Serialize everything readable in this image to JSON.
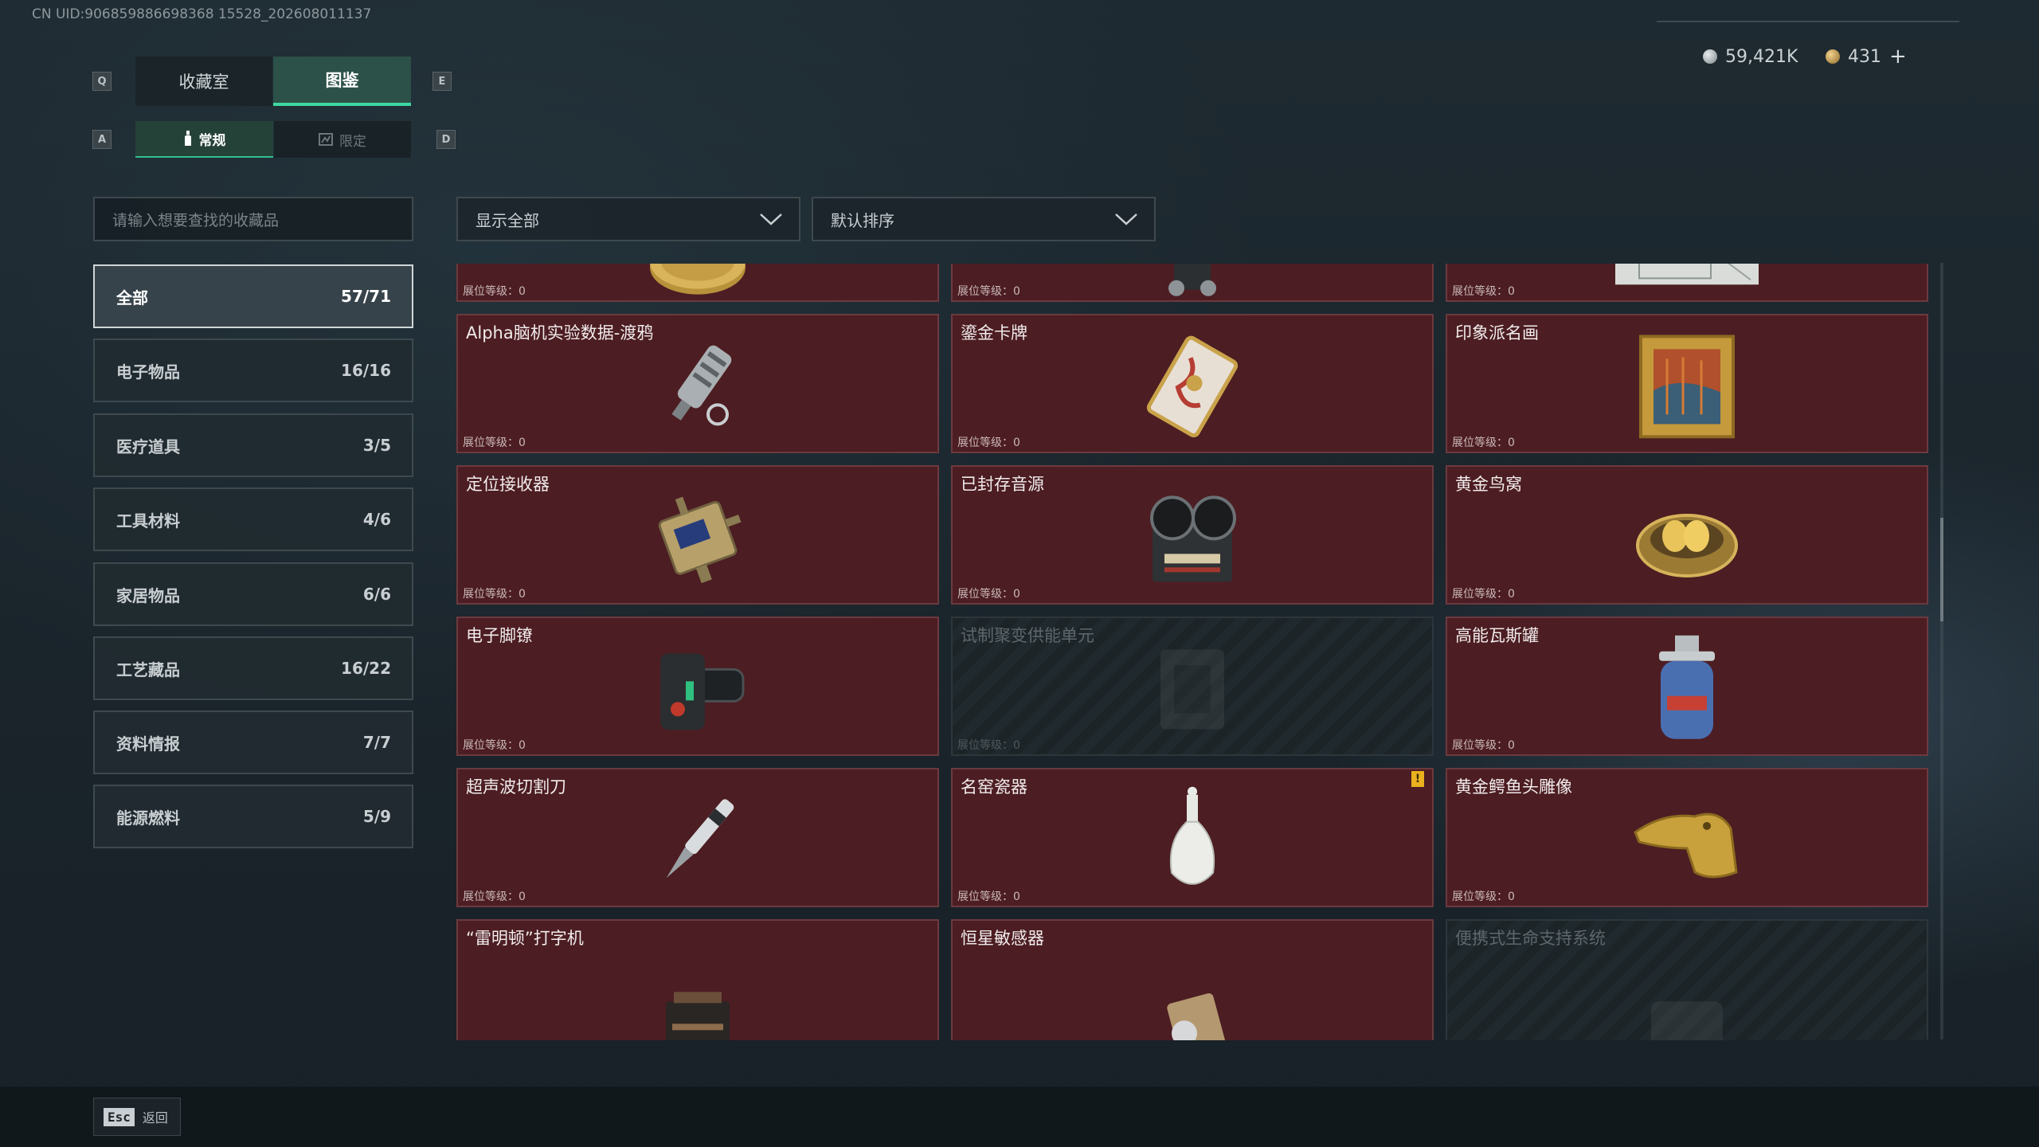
{
  "header": {
    "uid": "CN UID:906859886698368 15528_202608011137",
    "hint_left_top": "Q",
    "hint_right_top": "E",
    "hint_left_sub": "A",
    "hint_right_sub": "D",
    "tabs": [
      "收藏室",
      "图鉴"
    ],
    "subtabs": [
      "常规",
      "限定"
    ],
    "currency": [
      {
        "value": "59,421K",
        "color": "#b9c0c4"
      },
      {
        "value": "431",
        "color": "#c8a15a"
      }
    ],
    "add_label": "+"
  },
  "search": {
    "placeholder": "请输入想要查找的收藏品"
  },
  "filters": {
    "show": "显示全部",
    "sort": "默认排序"
  },
  "categories": [
    {
      "label": "全部",
      "count": "57/71"
    },
    {
      "label": "电子物品",
      "count": "16/16"
    },
    {
      "label": "医疗道具",
      "count": "3/5"
    },
    {
      "label": "工具材料",
      "count": "4/6"
    },
    {
      "label": "家居物品",
      "count": "6/6"
    },
    {
      "label": "工艺藏品",
      "count": "16/22"
    },
    {
      "label": "资料情报",
      "count": "7/7"
    },
    {
      "label": "能源燃料",
      "count": "5/9"
    }
  ],
  "level_label": "展位等级：0",
  "items": [
    {
      "name": "",
      "icon": "caviar-tin-icon",
      "locked": false
    },
    {
      "name": "",
      "icon": "old-telephone-icon",
      "locked": false
    },
    {
      "name": "",
      "icon": "blueprint-map-icon",
      "locked": false
    },
    {
      "name": "Alpha脑机实验数据-渡鸦",
      "icon": "data-capsule-icon",
      "locked": false
    },
    {
      "name": "鎏金卡牌",
      "icon": "gilded-card-icon",
      "locked": false
    },
    {
      "name": "印象派名画",
      "icon": "framed-painting-icon",
      "locked": false
    },
    {
      "name": "定位接收器",
      "icon": "locator-receiver-icon",
      "locked": false
    },
    {
      "name": "已封存音源",
      "icon": "reel-recorder-icon",
      "locked": false
    },
    {
      "name": "黄金鸟窝",
      "icon": "golden-nest-icon",
      "locked": false
    },
    {
      "name": "电子脚镣",
      "icon": "ankle-monitor-icon",
      "locked": false
    },
    {
      "name": "试制聚变供能单元",
      "icon": "fusion-unit-icon",
      "locked": true
    },
    {
      "name": "高能瓦斯罐",
      "icon": "gas-canister-icon",
      "locked": false
    },
    {
      "name": "超声波切割刀",
      "icon": "ultrasonic-knife-icon",
      "locked": false
    },
    {
      "name": "名窑瓷器",
      "icon": "porcelain-vase-icon",
      "locked": false,
      "badge": "!"
    },
    {
      "name": "黄金鳄鱼头雕像",
      "icon": "golden-crocodile-icon",
      "locked": false
    },
    {
      "name": "“雷明顿”打字机",
      "icon": "typewriter-icon",
      "locked": false
    },
    {
      "name": "恒星敏感器",
      "icon": "star-sensor-icon",
      "locked": false
    },
    {
      "name": "便携式生命支持系统",
      "icon": "life-support-icon",
      "locked": true
    }
  ],
  "footer": {
    "esc_key": "Esc",
    "esc_label": "返回"
  }
}
